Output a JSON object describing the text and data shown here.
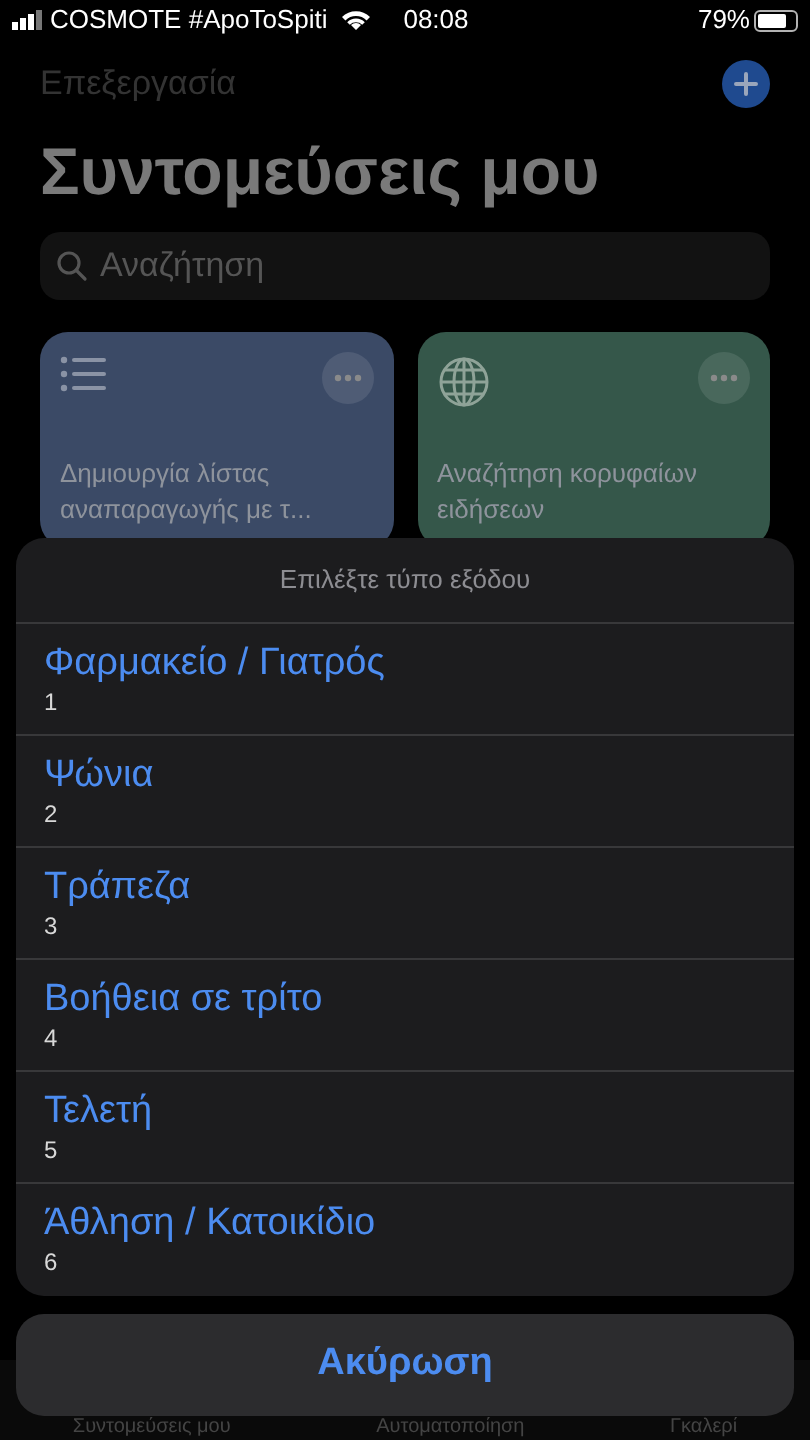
{
  "status_bar": {
    "carrier": "COSMOTE #ApoToSpiti",
    "time": "08:08",
    "battery": "79%"
  },
  "nav": {
    "edit": "Επεξεργασία",
    "title": "Συντομεύσεις μου"
  },
  "search": {
    "placeholder": "Αναζήτηση"
  },
  "shortcuts": [
    {
      "kind": "list",
      "title": "Δημιουργία λίστας αναπαραγωγής με τ...",
      "color": "#3b4a66"
    },
    {
      "kind": "globe",
      "title": "Αναζήτηση κορυφαίων ειδήσεων",
      "color": "#35574a"
    }
  ],
  "action_sheet": {
    "title": "Επιλέξτε τύπο εξόδου",
    "options": [
      {
        "label": "Φαρμακείο / Γιατρός",
        "subtitle": "1"
      },
      {
        "label": "Ψώνια",
        "subtitle": "2"
      },
      {
        "label": "Τράπεζα",
        "subtitle": "3"
      },
      {
        "label": "Βοήθεια σε τρίτο",
        "subtitle": "4"
      },
      {
        "label": "Τελετή",
        "subtitle": "5"
      },
      {
        "label": "Άθληση / Κατοικίδιο",
        "subtitle": "6"
      }
    ],
    "cancel": "Ακύρωση"
  },
  "tab_bar": [
    {
      "label": "Συντομεύσεις μου"
    },
    {
      "label": "Αυτοματοποίηση"
    },
    {
      "label": "Γκαλερί"
    }
  ]
}
